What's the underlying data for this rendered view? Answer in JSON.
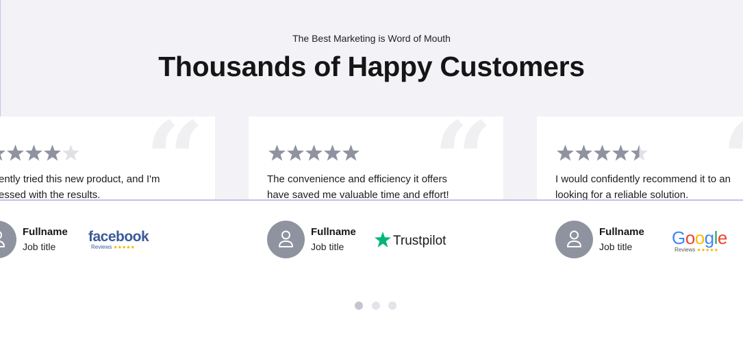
{
  "section": {
    "eyebrow": "The Best Marketing is Word of Mouth",
    "headline": "Thousands of Happy Customers"
  },
  "colors": {
    "star_filled": "#8f939f",
    "star_empty": "#e0e1e6",
    "background_band": "#f2f2f7"
  },
  "testimonials": [
    {
      "rating": 4,
      "line1": "ently tried this new product, and I'm",
      "line2": "essed with the results.",
      "name": "Fullname",
      "job": "Job title",
      "platform": "facebook",
      "platform_sub": "Reviews",
      "platform_icon": "facebook-reviews-logo"
    },
    {
      "rating": 5,
      "line1": "The convenience and efficiency it offers",
      "line2": "have saved me valuable time and effort!",
      "name": "Fullname",
      "job": "Job title",
      "platform": "Trustpilot",
      "platform_icon": "trustpilot-logo"
    },
    {
      "rating": 4.5,
      "line1": "I would confidently recommend it to an",
      "line2": "looking for a reliable solution.",
      "name": "Fullname",
      "job": "Job title",
      "platform": "Google",
      "platform_sub": "Reviews",
      "platform_icon": "google-reviews-logo"
    }
  ],
  "pagination": {
    "pages": 3,
    "active": 1
  }
}
